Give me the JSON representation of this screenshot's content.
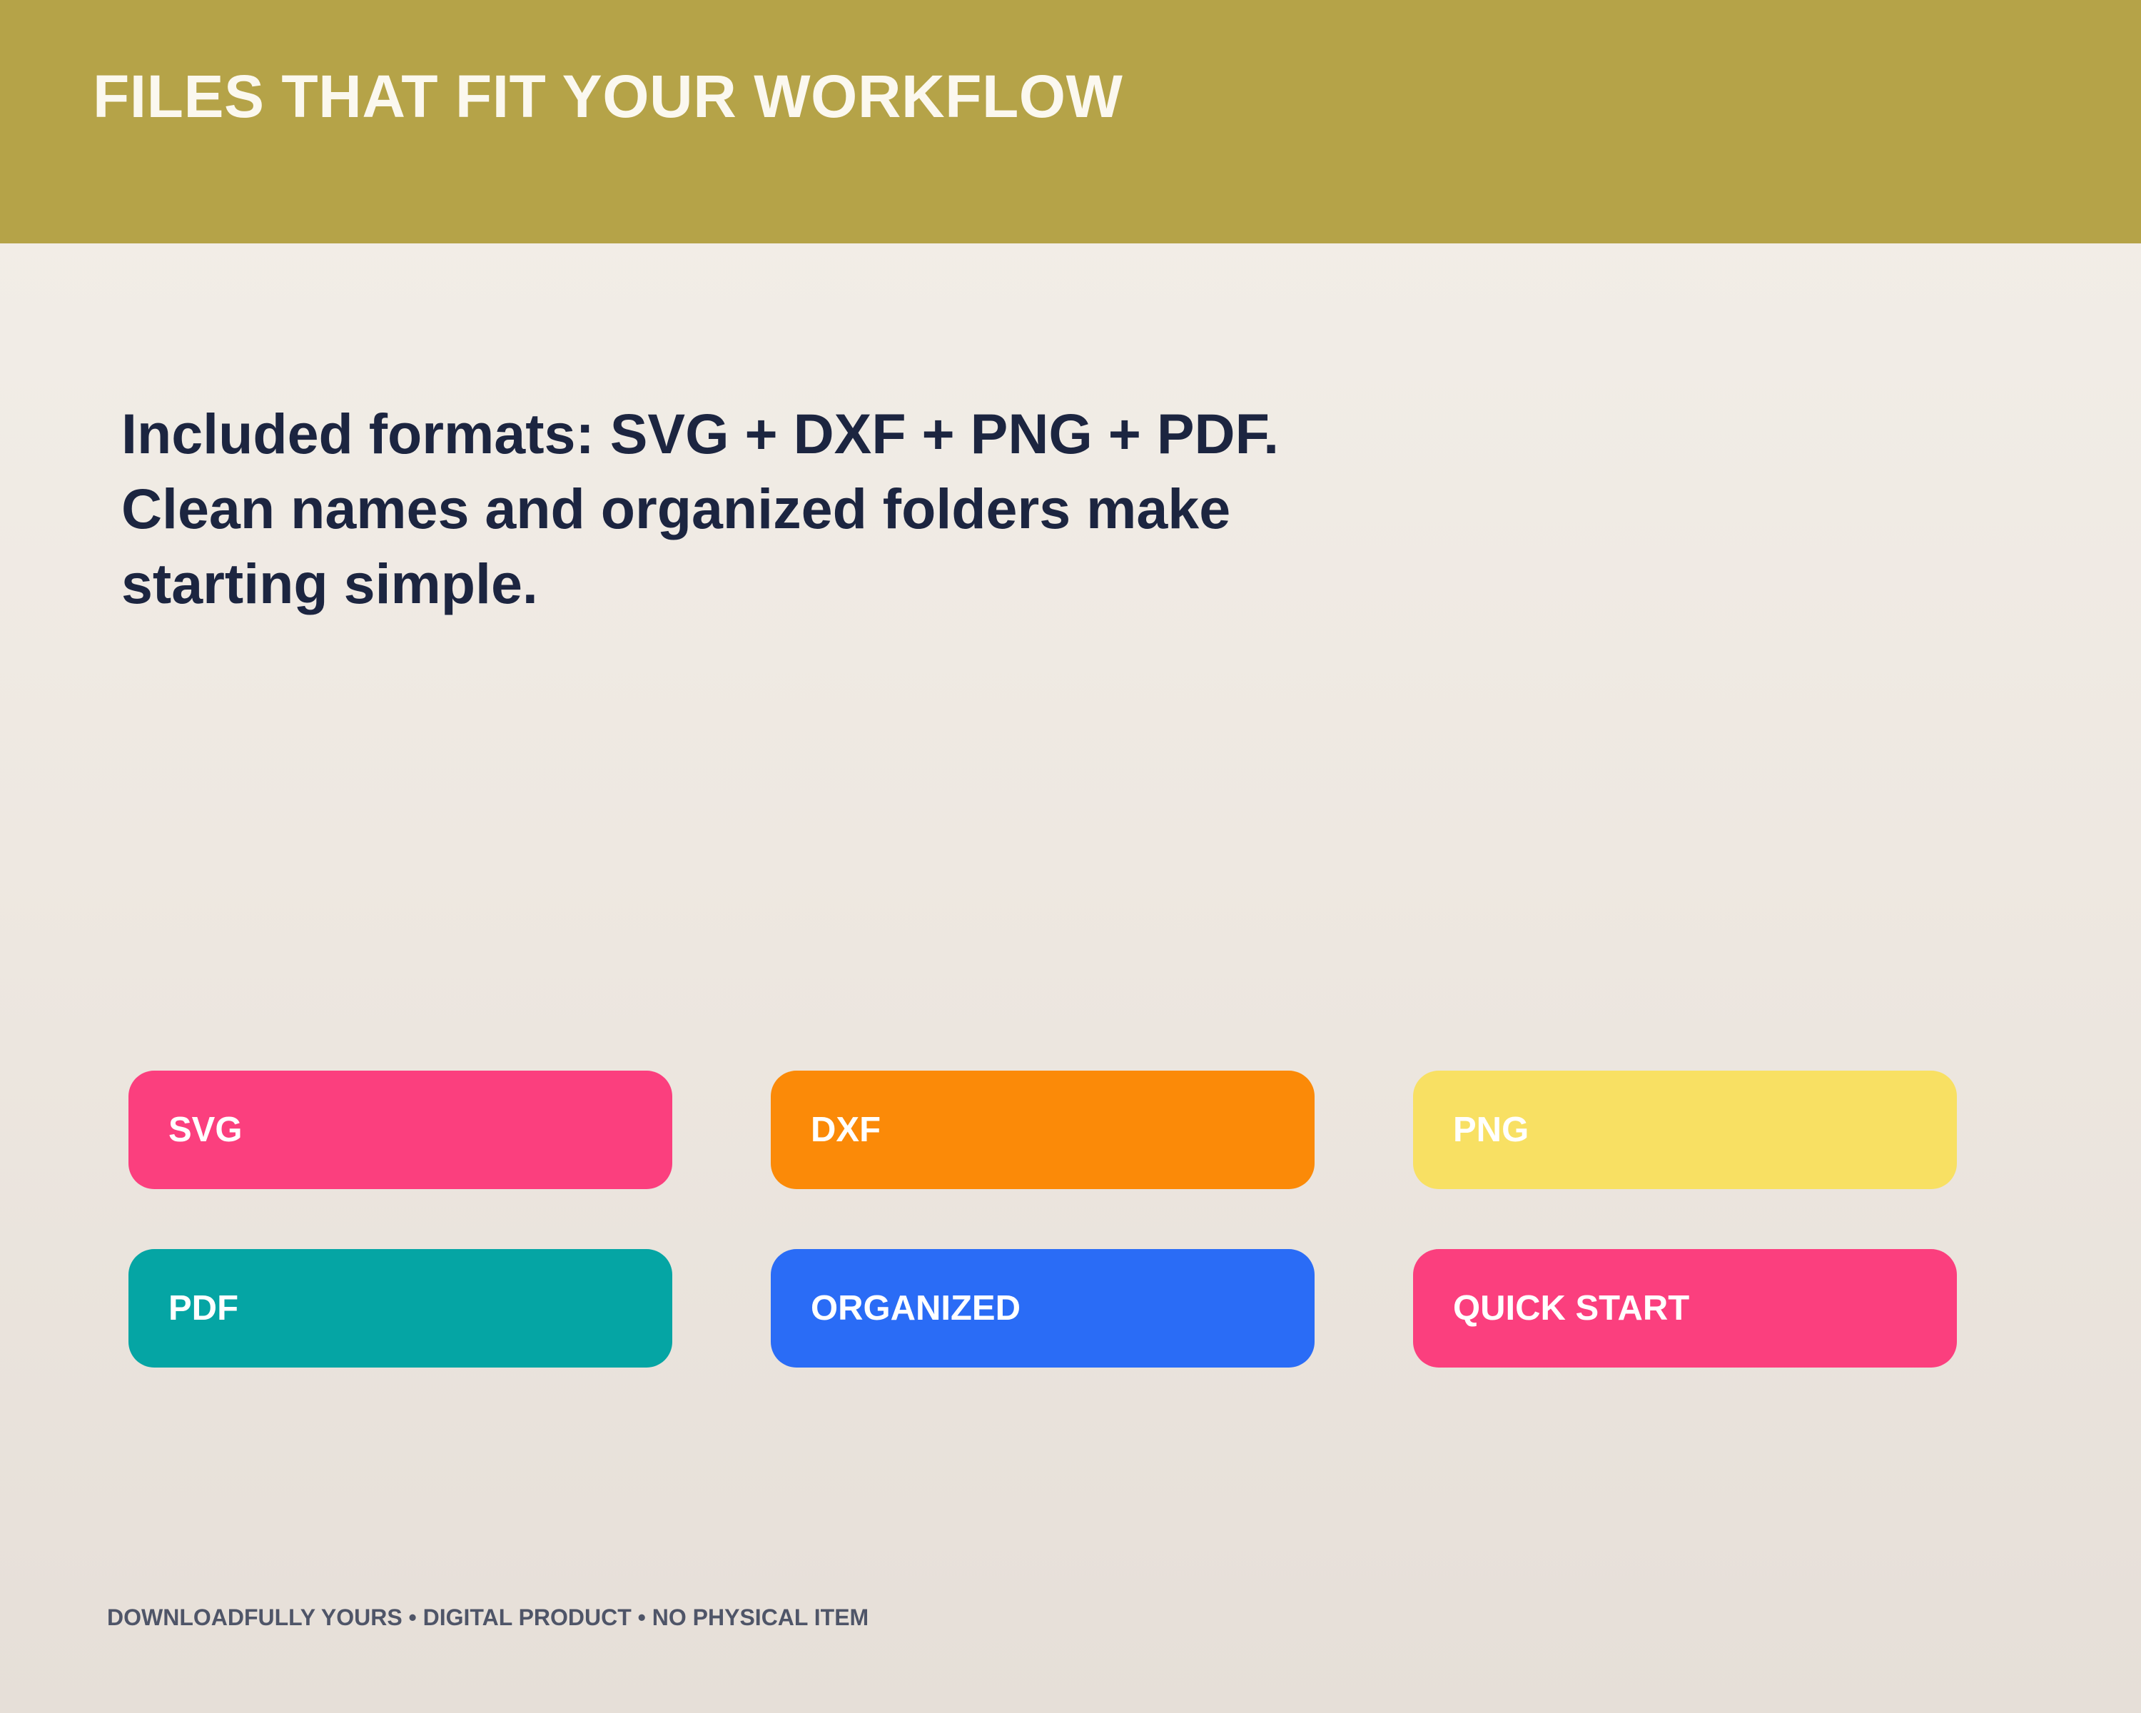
{
  "header": {
    "title": "FILES THAT FIT YOUR WORKFLOW",
    "background_color": "#b5a348"
  },
  "intro": {
    "lines": [
      "Included formats: SVG + DXF + PNG + PDF.",
      "Clean names and organized folders make",
      "starting simple."
    ]
  },
  "chips": [
    {
      "label": "SVG",
      "color": "#fb3f7e"
    },
    {
      "label": "DXF",
      "color": "#fb8a08"
    },
    {
      "label": "PNG",
      "color": "#f8e063"
    },
    {
      "label": "PDF",
      "color": "#05a5a4"
    },
    {
      "label": "ORGANIZED",
      "color": "#2a6cf6"
    },
    {
      "label": "QUICK START",
      "color": "#fb3f7e"
    }
  ],
  "footer": {
    "text": "DOWNLOADFULLY YOURS • DIGITAL PRODUCT • NO PHYSICAL ITEM"
  }
}
